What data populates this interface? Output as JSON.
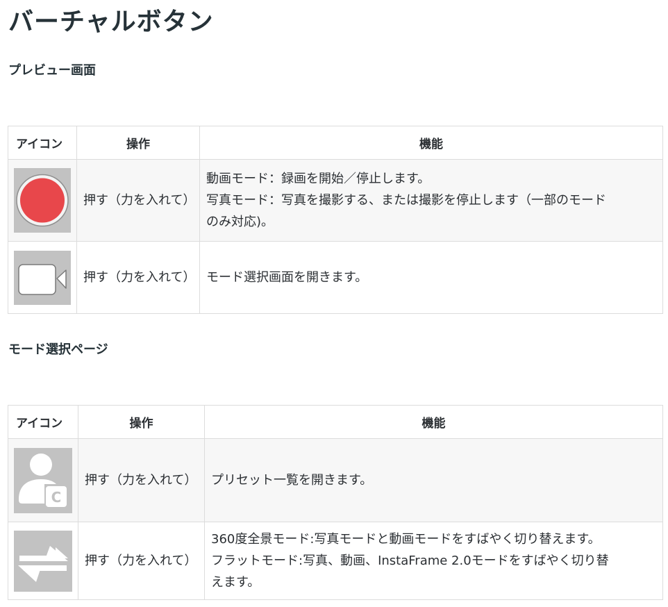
{
  "title": "バーチャルボタン",
  "sections": [
    {
      "heading": "プレビュー画面",
      "headers": {
        "icon": "アイコン",
        "operation": "操作",
        "function": "機能"
      },
      "rows": [
        {
          "icon": "record-button-icon",
          "operation": "押す（力を入れて）",
          "function_lines": [
            "動画モード：録画を開始／停止します。",
            "写真モード：写真を撮影する、または撮影を停止します（一部のモード",
            "のみ対応)。"
          ]
        },
        {
          "icon": "video-camera-icon",
          "operation": "押す（力を入れて）",
          "function_lines": [
            "モード選択画面を開きます。"
          ]
        }
      ]
    },
    {
      "heading": "モード選択ページ",
      "headers": {
        "icon": "アイコン",
        "operation": "操作",
        "function": "機能"
      },
      "rows": [
        {
          "icon": "preset-user-icon",
          "operation": "押す（力を入れて）",
          "function_lines": [
            "プリセット一覧を開きます。"
          ]
        },
        {
          "icon": "switch-arrows-icon",
          "operation": "押す（力を入れて）",
          "function_lines": [
            "360度全景モード:写真モードと動画モードをすばやく切り替えます。",
            "フラットモード:写真、動画、InstaFrame 2.0モードをすばやく切り替",
            "えます。"
          ]
        }
      ]
    }
  ],
  "colors": {
    "record_red": "#e8474b",
    "icon_bg": "#c2c2c2",
    "border": "#dcdcdc",
    "row_shade": "#f7f7f7",
    "heading": "#263238"
  }
}
